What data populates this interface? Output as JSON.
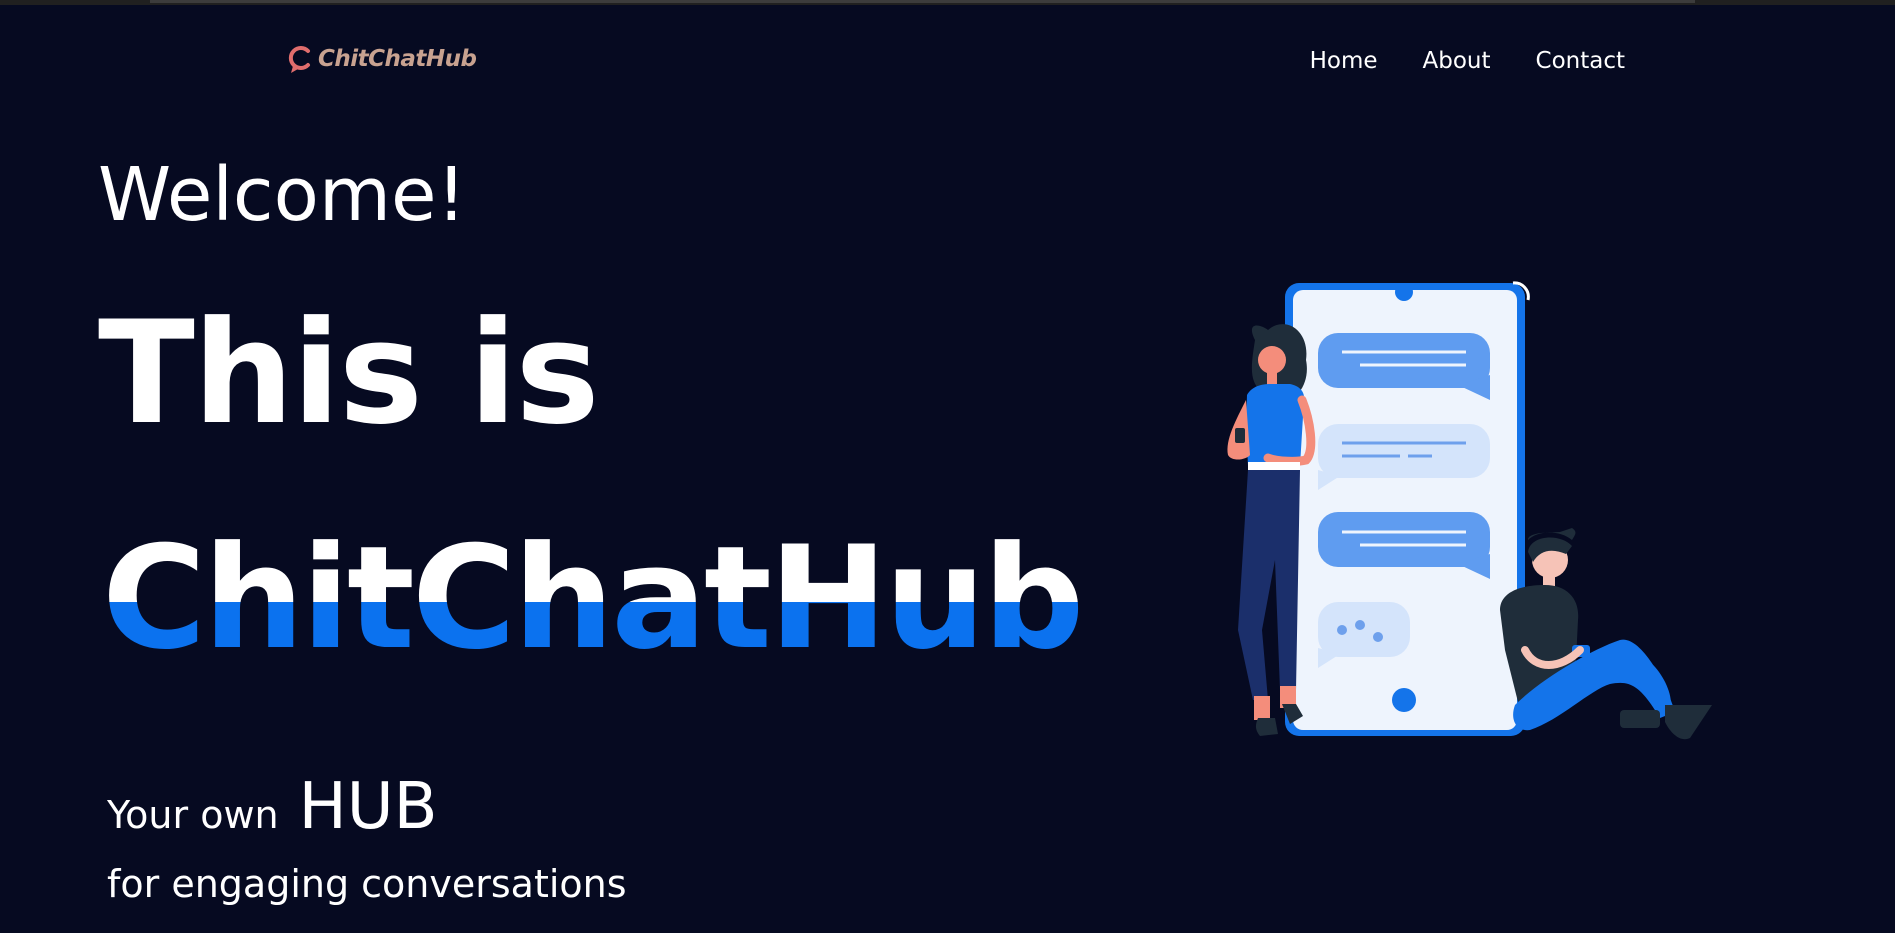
{
  "header": {
    "logo_text": "ChitChatHub",
    "logo_icon": "chat-bubble-icon",
    "nav": [
      {
        "label": "Home"
      },
      {
        "label": "About"
      },
      {
        "label": "Contact"
      }
    ]
  },
  "hero": {
    "welcome": "Welcome!",
    "line1": "This is",
    "brand": "ChitChatHub",
    "tagline_small": "Your own",
    "tagline_big": "HUB",
    "tagline_2": "for engaging conversations",
    "illustration": "people-chatting-phone-illustration"
  },
  "colors": {
    "background": "#060a21",
    "accent": "#0b72ef",
    "logo": "#c8a290",
    "text": "#ffffff"
  }
}
